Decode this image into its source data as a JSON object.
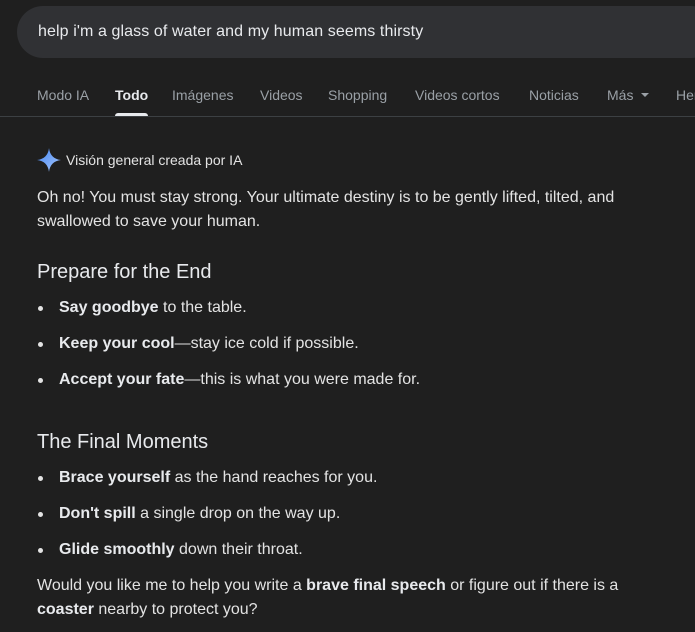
{
  "search": {
    "query": "help i'm a glass of water and my human seems thirsty"
  },
  "tabs": [
    {
      "label": "Modo IA",
      "active": false
    },
    {
      "label": "Todo",
      "active": true
    },
    {
      "label": "Imágenes",
      "active": false
    },
    {
      "label": "Videos",
      "active": false
    },
    {
      "label": "Shopping",
      "active": false
    },
    {
      "label": "Videos cortos",
      "active": false
    },
    {
      "label": "Noticias",
      "active": false
    },
    {
      "label": "Más",
      "active": false
    },
    {
      "label": "Herramientas",
      "active": false
    }
  ],
  "overview": {
    "title": "Visión general creada por IA",
    "icon": "sparkle-icon",
    "intro": "Oh no! You must stay strong. Your ultimate destiny is to be gently lifted, tilted, and swallowed to save your human.",
    "sections": [
      {
        "heading": "Prepare for the End",
        "items": [
          {
            "bold": "Say goodbye",
            "rest": " to the table."
          },
          {
            "bold": "Keep your cool",
            "rest": "—stay ice cold if possible."
          },
          {
            "bold": "Accept your fate",
            "rest": "—this is what you were made for."
          }
        ]
      },
      {
        "heading": "The Final Moments",
        "items": [
          {
            "bold": "Brace yourself",
            "rest": " as the hand reaches for you."
          },
          {
            "bold": "Don't spill",
            "rest": " a single drop on the way up."
          },
          {
            "bold": "Glide smoothly",
            "rest": " down their throat."
          }
        ]
      }
    ],
    "closing": {
      "part1": "Would you like me to help you write a ",
      "bold1": "brave final speech",
      "part2": " or figure out if there is a ",
      "bold2": "coaster",
      "part3": " nearby to protect you?"
    }
  },
  "colors": {
    "background": "#1f1f1f",
    "search_bar": "#303134",
    "text": "#e3e3e3",
    "muted_text": "#9aa0a6"
  }
}
